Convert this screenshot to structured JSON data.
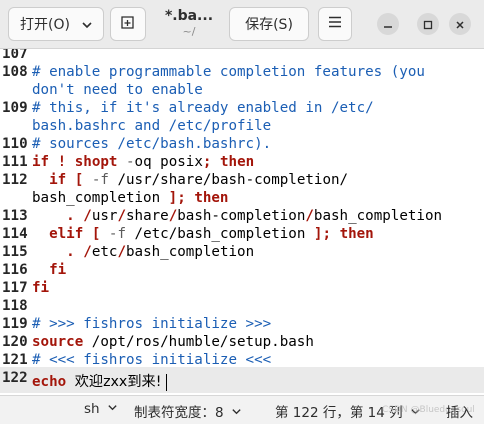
{
  "header": {
    "open_label": "打开(O)",
    "title": "*.ba...",
    "subtitle": "~/",
    "save_label": "保存(S)"
  },
  "icons": {
    "open_dropdown": "chevron-down-icon",
    "new_tab": "new-tab-icon",
    "menu": "hamburger-menu-icon",
    "minimize": "minimize-icon",
    "maximize": "maximize-icon",
    "close": "close-icon"
  },
  "editor": {
    "lines": [
      {
        "num": "107",
        "code": ""
      },
      {
        "num": "108",
        "code": "# enable programmable completion features (you"
      },
      {
        "num": "",
        "code": "don't need to enable"
      },
      {
        "num": "109",
        "code": "# this, if it's already enabled in /etc/"
      },
      {
        "num": "",
        "code": "bash.bashrc and /etc/profile"
      },
      {
        "num": "110",
        "code": "# sources /etc/bash.bashrc)."
      },
      {
        "num": "111",
        "code": "if ! shopt -oq posix; then"
      },
      {
        "num": "112",
        "code": "  if [ -f /usr/share/bash-completion/"
      },
      {
        "num": "",
        "code": "bash_completion ]; then"
      },
      {
        "num": "113",
        "code": "    . /usr/share/bash-completion/bash_completion"
      },
      {
        "num": "114",
        "code": "  elif [ -f /etc/bash_completion ]; then"
      },
      {
        "num": "115",
        "code": "    . /etc/bash_completion"
      },
      {
        "num": "116",
        "code": "  fi"
      },
      {
        "num": "117",
        "code": "fi"
      },
      {
        "num": "118",
        "code": ""
      },
      {
        "num": "119",
        "code": "# >>> fishros initialize >>>"
      },
      {
        "num": "120",
        "code": "source /opt/ros/humble/setup.bash"
      },
      {
        "num": "121",
        "code": "# <<< fishros initialize <<<"
      },
      {
        "num": "122",
        "code": "echo 欢迎zxx到来!"
      }
    ],
    "cursor_line": "122"
  },
  "statusbar": {
    "language": "sh",
    "tab_width": "制表符宽度：8",
    "position": "第 122 行，第 14 列",
    "mode": "插入",
    "watermark": "CSDN @Bluedgesoul"
  },
  "colors": {
    "comment": "#1b5eb4",
    "keyword": "#a3150a",
    "current_line": "#eaeaea"
  }
}
